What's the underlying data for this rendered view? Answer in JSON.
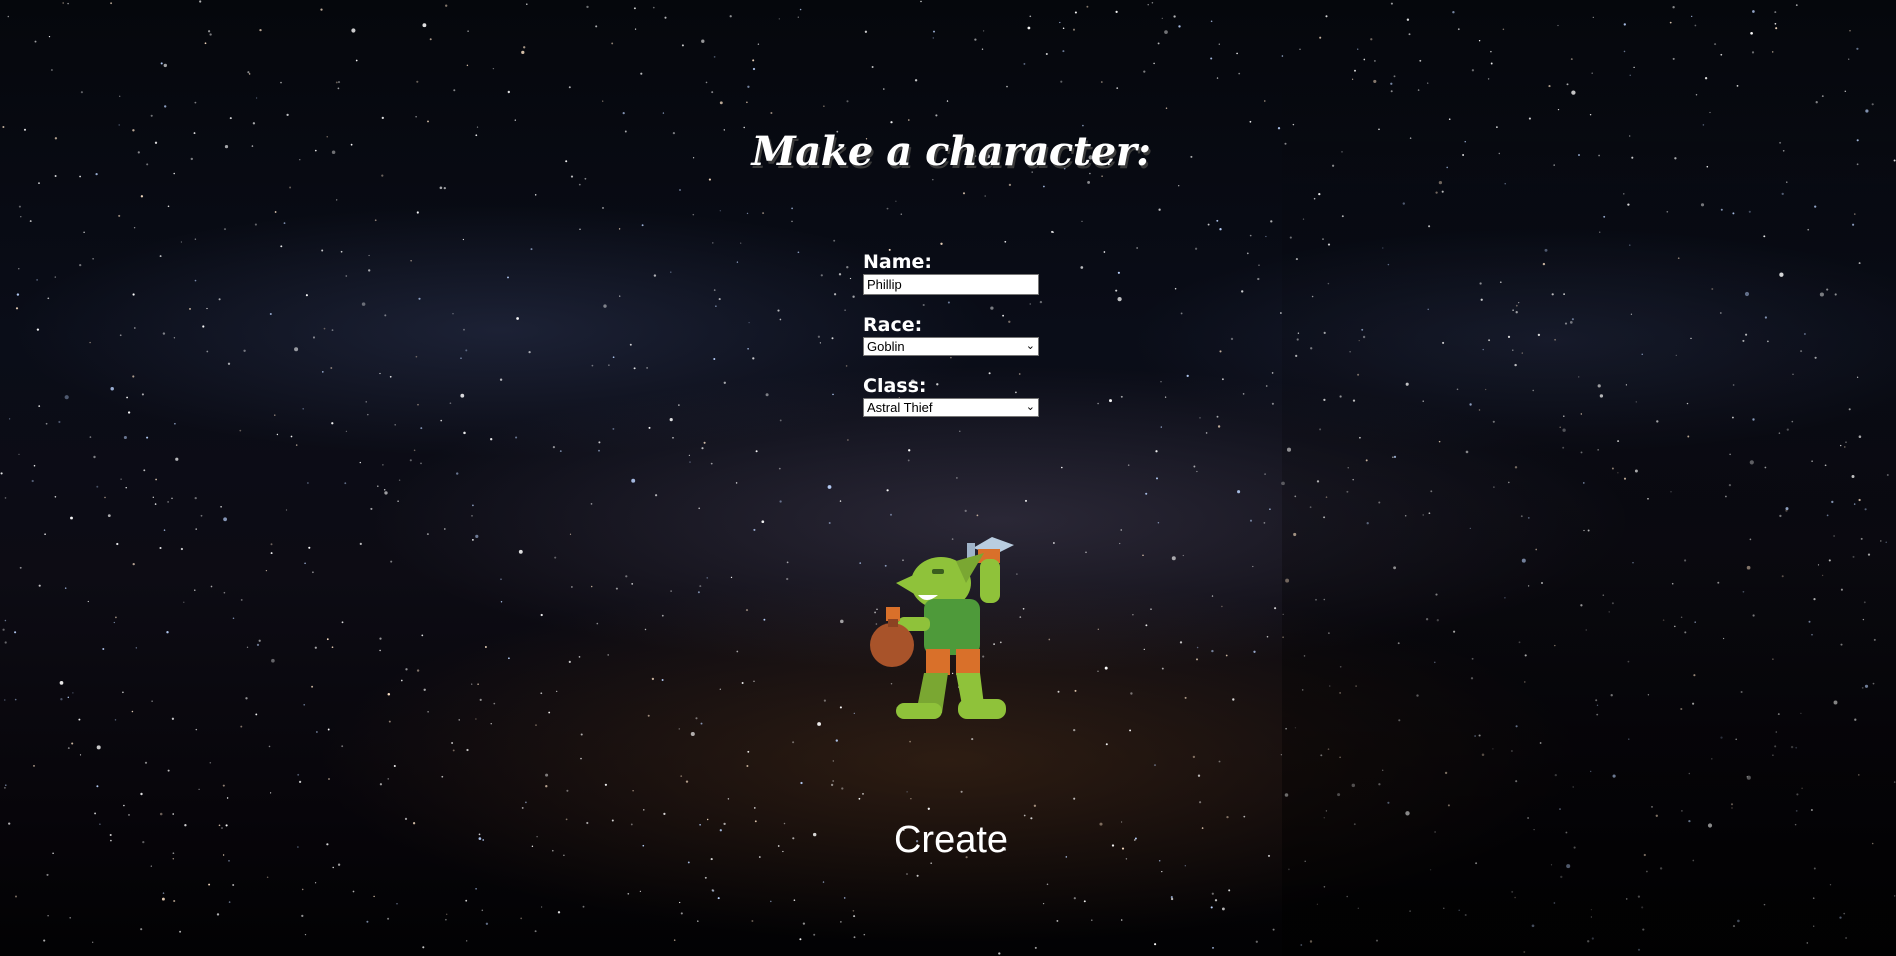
{
  "heading": "Make a character:",
  "form": {
    "name": {
      "label": "Name:",
      "value": "Phillip"
    },
    "race": {
      "label": "Race:",
      "selected": "Goblin"
    },
    "class": {
      "label": "Class:",
      "selected": "Astral Thief"
    }
  },
  "character_image": {
    "icon": "goblin-thief-icon"
  },
  "create_button": {
    "label": "Create"
  },
  "colors": {
    "goblin_skin": "#8fc23a",
    "goblin_shirt": "#4e9a3a",
    "goblin_pants": "#d9702a",
    "loot_bag": "#a8532a",
    "dagger": "#b9cde0"
  }
}
